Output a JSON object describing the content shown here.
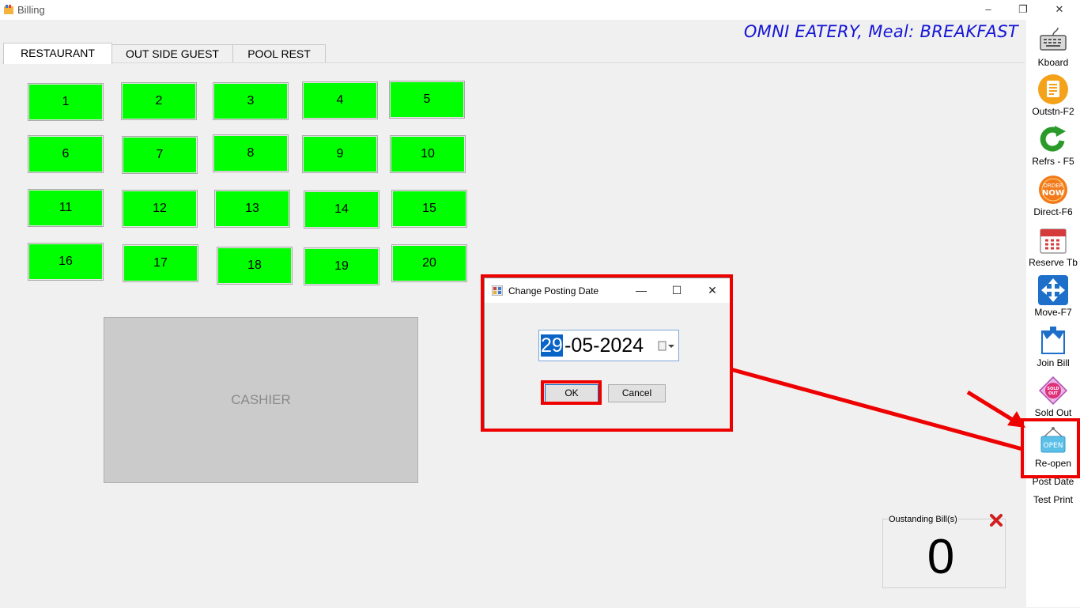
{
  "window": {
    "title": "Billing",
    "controls": {
      "minimize": "–",
      "restore": "❐",
      "close": "✕"
    }
  },
  "banner": "OMNI EATERY, Meal: BREAKFAST",
  "tabs": [
    "RESTAURANT",
    "OUT SIDE GUEST",
    "POOL REST"
  ],
  "active_tab": "RESTAURANT",
  "tables": [
    "1",
    "2",
    "3",
    "4",
    "5",
    "6",
    "7",
    "8",
    "9",
    "10",
    "11",
    "12",
    "13",
    "14",
    "15",
    "16",
    "17",
    "18",
    "19",
    "20"
  ],
  "table_color": "#00ff00",
  "cashier_label": "CASHIER",
  "sidebar": {
    "items": [
      {
        "label": "Kboard",
        "icon": "keyboard-icon"
      },
      {
        "label": "Outstn-F2",
        "icon": "document-icon"
      },
      {
        "label": "Refrs - F5",
        "icon": "refresh-icon"
      },
      {
        "label": "Direct-F6",
        "icon": "order-now-icon"
      },
      {
        "label": "Reserve Tb",
        "icon": "calendar-icon"
      },
      {
        "label": "Move-F7",
        "icon": "move-arrows-icon"
      },
      {
        "label": "Join Bill",
        "icon": "join-bill-icon"
      },
      {
        "label": "Sold Out",
        "icon": "sold-out-tag-icon"
      },
      {
        "label": "Re-open",
        "icon": "open-sign-icon"
      }
    ],
    "text_items": [
      "Post Date",
      "Test Print"
    ],
    "order_now_icon_text": [
      "ORDER",
      "NOW"
    ],
    "sold_out_icon_text": [
      "SOLD",
      "OUT"
    ],
    "open_icon_text": "OPEN"
  },
  "outstanding": {
    "label": "Oustanding Bill(s)",
    "count": "0"
  },
  "dialog": {
    "title": "Change Posting Date",
    "controls": {
      "minimize": "—",
      "maximize": "☐",
      "close": "✕"
    },
    "date": {
      "day": "29",
      "rest": "-05-2024"
    },
    "ok_label": "OK",
    "cancel_label": "Cancel"
  },
  "highlight_color": "#ee0000"
}
